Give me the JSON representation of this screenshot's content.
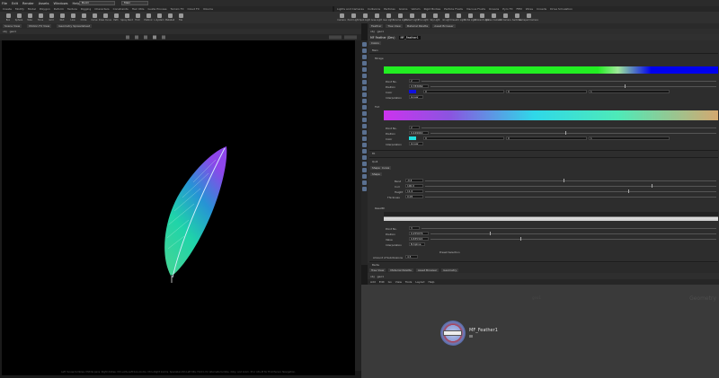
{
  "menubar": {
    "items": [
      "File",
      "Edit",
      "Render",
      "Assets",
      "Windows",
      "Help"
    ],
    "desktop": "Build",
    "main": "Main"
  },
  "shelf_left": {
    "tabs": [
      "Create",
      "Modify",
      "Model",
      "Polygon",
      "Deform",
      "Texture",
      "Rigging",
      "Characters",
      "Constraints",
      "Hair Utils",
      "Guide Process",
      "Terrain FX",
      "Cloud FX",
      "Volume"
    ]
  },
  "shelf_right": {
    "tabs": [
      "Lights and Cameras",
      "Collisions",
      "Particles",
      "Grains",
      "Vellum",
      "Rigid Bodies",
      "Particle Fluids",
      "Viscous Fluids",
      "Oceans",
      "Pyro FX",
      "FEM",
      "Wires",
      "Crowds",
      "Drive Simulation"
    ]
  },
  "tools": [
    {
      "label": "Box"
    },
    {
      "label": "Sphere"
    },
    {
      "label": "Tube"
    },
    {
      "label": "Torus"
    },
    {
      "label": "Grid"
    },
    {
      "label": "Null"
    },
    {
      "label": "Line"
    },
    {
      "label": "Circle"
    },
    {
      "label": "Curve"
    },
    {
      "label": "Draw Curve"
    },
    {
      "label": "Path"
    },
    {
      "label": "Spray Paint"
    },
    {
      "label": "Font"
    },
    {
      "label": "Platonic"
    },
    {
      "label": "L-System"
    },
    {
      "label": "Metaball"
    },
    {
      "label": "File"
    }
  ],
  "tools_right": [
    {
      "label": "Camera"
    },
    {
      "label": "Point Light"
    },
    {
      "label": "Spot Light"
    },
    {
      "label": "Area Light"
    },
    {
      "label": "Geo Light"
    },
    {
      "label": "Volume Light"
    },
    {
      "label": "Distant Light"
    },
    {
      "label": "Env Light"
    },
    {
      "label": "Sky Light"
    },
    {
      "label": "GI Light"
    },
    {
      "label": "Caustic Light"
    },
    {
      "label": "Portal Light"
    },
    {
      "label": "Ambient Light"
    },
    {
      "label": "Stereo Camera"
    },
    {
      "label": "VR Camera"
    },
    {
      "label": "Switcher"
    },
    {
      "label": "Gamepad Camera"
    }
  ],
  "viewport": {
    "tabs": [
      "Scene View",
      "Motion FX View",
      "Geometry Spreadsheet"
    ],
    "path": [
      "obj",
      "geo1"
    ],
    "status": "Left mouse tumbles. Middle pans. Right dollies. Ctrl+Alt+Left box-zooms. Ctrl+Right zooms. Spacebar-Ctrl-Left tilts. Hold L for alternate tumble, dolly, and zoom.   M or Alt+M for First Person Navigation."
  },
  "params": {
    "tabs": [
      "Feather",
      "Tree View",
      "Material Palette",
      "Asset Browser"
    ],
    "path": [
      "obj",
      "geo1"
    ],
    "node_type": "MF Feather (Dev)",
    "node_name": "MF_Feather1",
    "shape_tab": "Colors",
    "section_main": "Main",
    "ramp1_label": "Mirage",
    "ramp2_label": "Tint",
    "point_no_label": "Point No.",
    "position_label": "Position",
    "color_label": "Color",
    "interp_label": "Interpolation",
    "interp_value": "Linear",
    "p1_point": "2",
    "p1_pos": "0.783069",
    "p1_c": [
      "0",
      "0",
      "1"
    ],
    "p2_point": "2",
    "p2_pos": "0.449940",
    "p2_c": [
      "0",
      "0",
      "1"
    ],
    "section_fit": "Fit",
    "section_quill": "Quill",
    "quill_tabs": [
      "Shape",
      "Curve"
    ],
    "shape_label": "Shape",
    "bend_label": "Bend",
    "bend_val": "-0.4",
    "curl_label": "Curl",
    "curl_val": "100.0",
    "height_label": "Height",
    "height_val": "11.0",
    "thickness_label": "Thickness",
    "thickness_val": "0.05",
    "ramp3_label": "Rewidth",
    "p3_point": "3",
    "p3_pos": "0.255076",
    "value_label": "Value",
    "p3_val": "0.835322",
    "interp3_value": "B-Spline",
    "preset_label": "Preset Selection",
    "amount_label": "Amount of Subdivisions",
    "amount_val": "4.5",
    "section_barbs": "Barbs",
    "swatch1": "#1010dd",
    "swatch2": "#22dddd",
    "accent": "#1f7a1f"
  },
  "network": {
    "tabs": [
      "Tree View",
      "Material Palette",
      "Asset Browser",
      "Geometry"
    ],
    "path": [
      "obj",
      "geo1"
    ],
    "menu": [
      "Add",
      "Edit",
      "Go",
      "View",
      "Tools",
      "Layout",
      "Help"
    ],
    "context": "geo1",
    "watermark": "Geometry",
    "node_label": "MF_Feather1"
  }
}
